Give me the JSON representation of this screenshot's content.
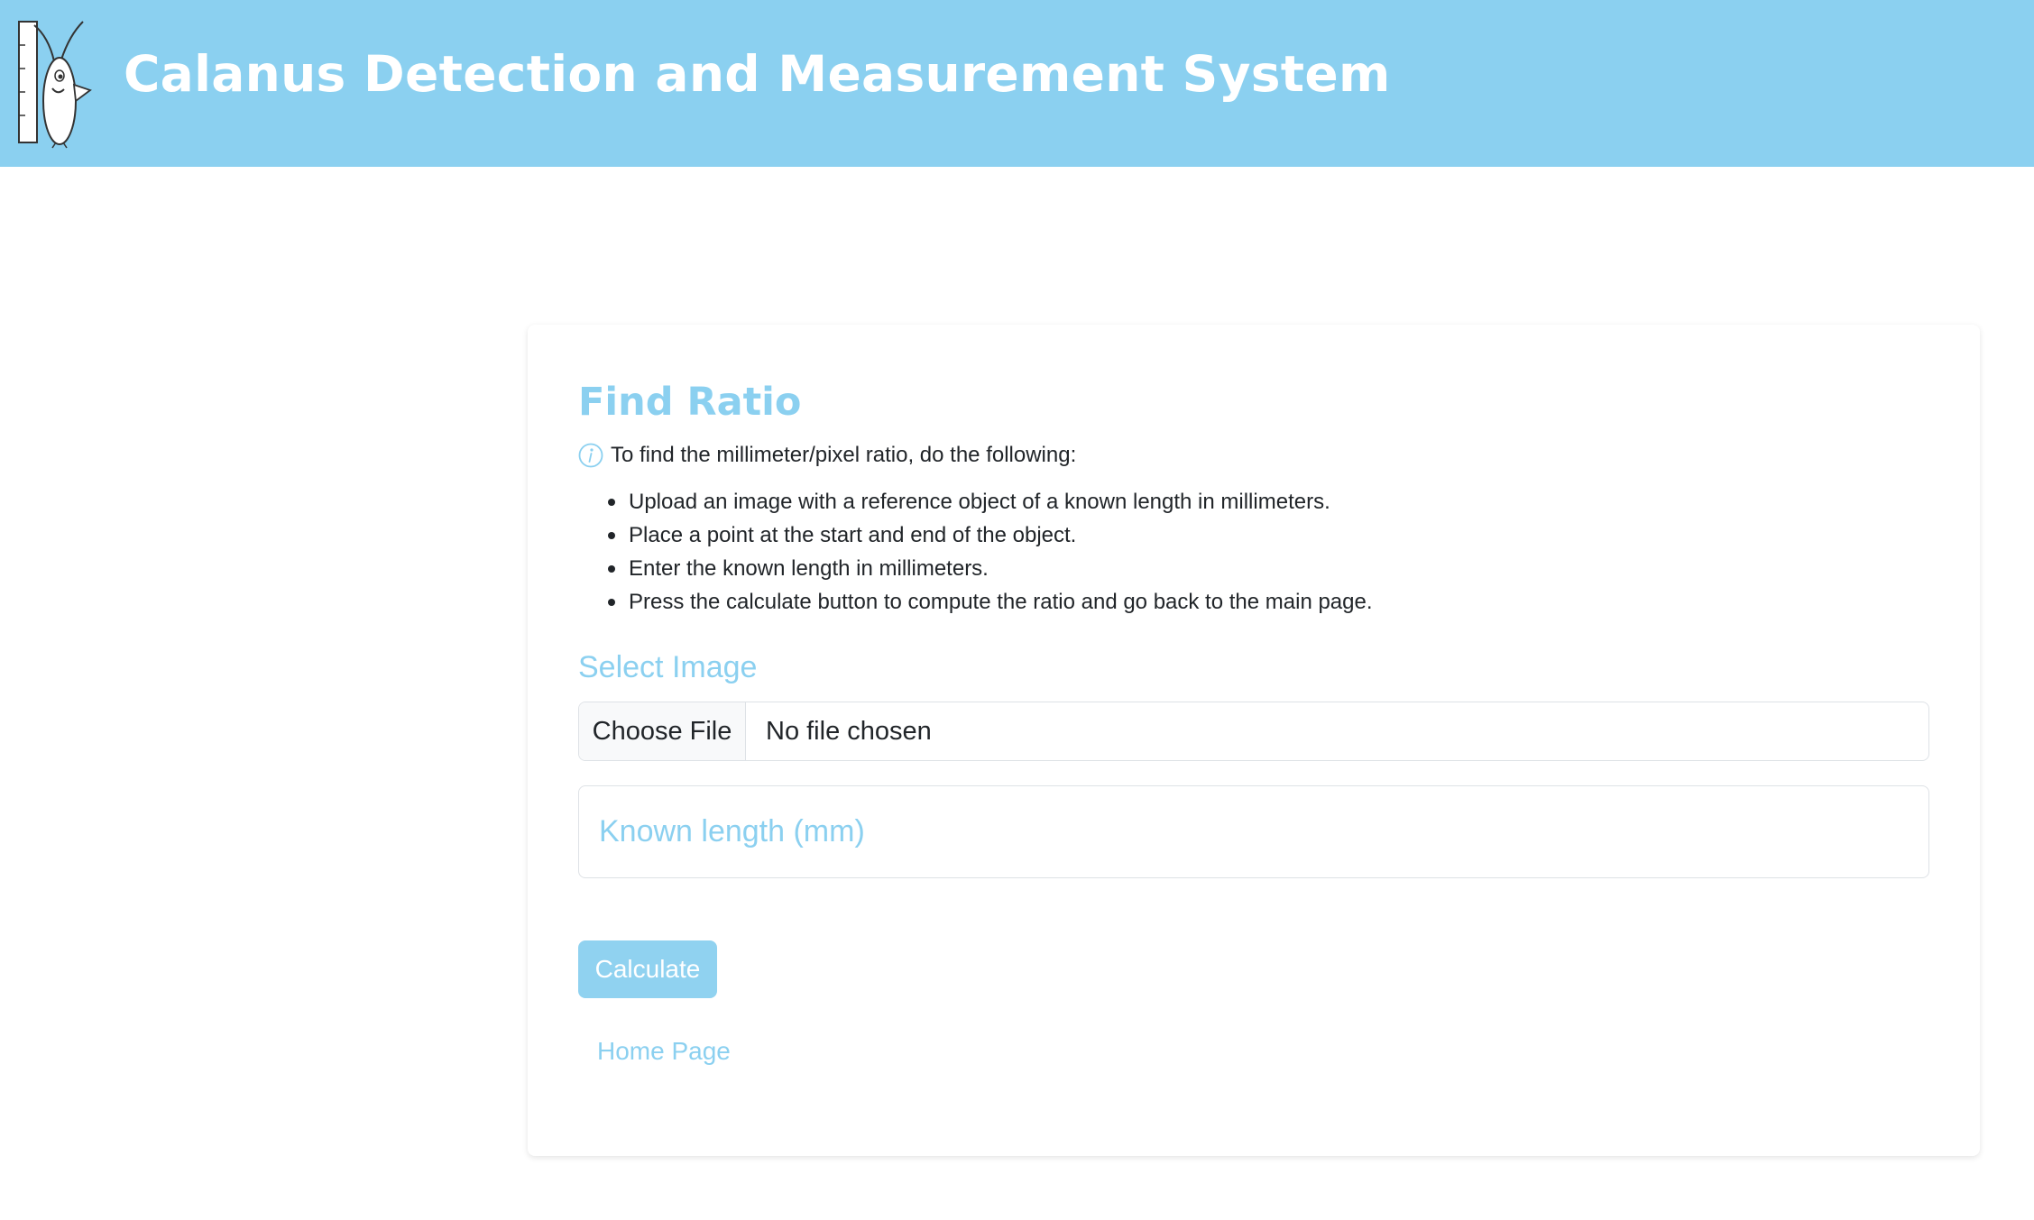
{
  "header": {
    "logo_icon": "calanus-copepod-with-ruler-logo",
    "title": "Calanus Detection and Measurement System",
    "background_color": "#8bd0f0"
  },
  "card": {
    "title": "Find Ratio",
    "info_icon": "info-circle-icon",
    "intro": "To find the millimeter/pixel ratio, do the following:",
    "steps": [
      "Upload an image with a reference object of a known length in millimeters.",
      "Place a point at the start and end of the object.",
      "Enter the known length in millimeters.",
      "Press the calculate button to compute the ratio and go back to the main page."
    ],
    "select_image_label": "Select Image",
    "file_input": {
      "button_label": "Choose File",
      "status": "No file chosen"
    },
    "known_length": {
      "value": "",
      "placeholder": "Known length (mm)"
    },
    "calculate_label": "Calculate",
    "home_link_label": "Home Page",
    "accent_color": "#8bd0f0"
  }
}
